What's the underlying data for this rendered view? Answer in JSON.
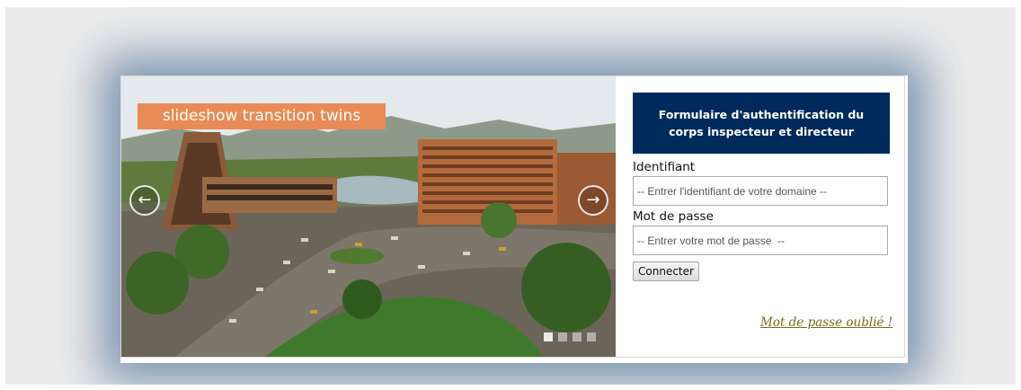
{
  "slideshow": {
    "caption": "slideshow transition twins",
    "prev_icon": "arrow-left-icon",
    "next_icon": "arrow-right-icon",
    "slide_count": 4,
    "active_slide": 1
  },
  "login_form": {
    "title": "Formulaire d'authentification du corps inspecteur et directeur",
    "username_label": "Identifiant",
    "username_placeholder": "-- Entrer l'identifiant de votre domaine --",
    "password_label": "Mot de passe",
    "password_placeholder": "-- Entrer votre mot de passe  --",
    "submit_label": "Connecter",
    "forgot_link": "Mot de passe oublié !"
  },
  "colors": {
    "title_bg": "#002a5c",
    "caption_bg": "#e98b56",
    "link": "#7a6a1c"
  }
}
